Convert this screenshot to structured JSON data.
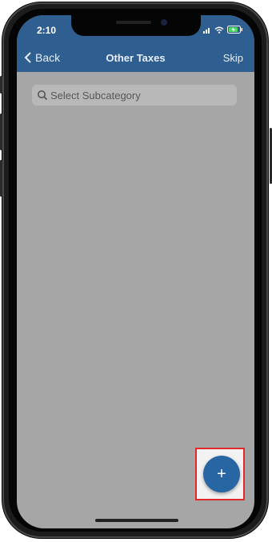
{
  "status_bar": {
    "time": "2:10",
    "icons": [
      "signal-icon",
      "wifi-icon",
      "battery-charging-icon"
    ]
  },
  "nav": {
    "back_label": "Back",
    "title": "Other Taxes",
    "skip_label": "Skip"
  },
  "search": {
    "placeholder": "Select Subcategory"
  },
  "fab": {
    "label": "+"
  },
  "colors": {
    "header": "#2e5f90",
    "overlay": "#a6a6a6",
    "fab": "#2866a3",
    "highlight": "#e02a2a"
  }
}
